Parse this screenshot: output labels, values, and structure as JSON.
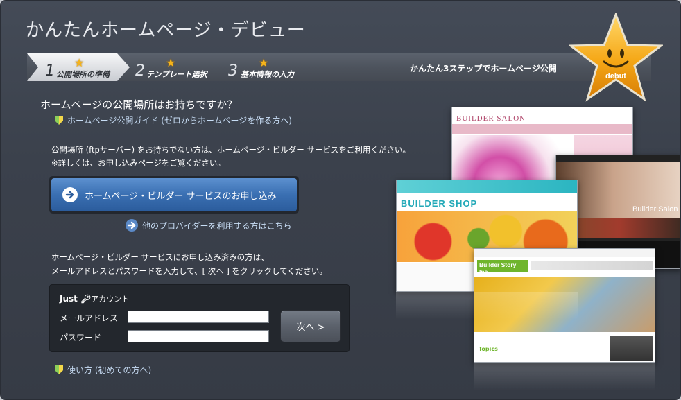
{
  "app_title": "かんたんホームページ・デビュー",
  "steps": [
    {
      "num": "1",
      "label": "公開場所の準備"
    },
    {
      "num": "2",
      "label": "テンプレート選択"
    },
    {
      "num": "3",
      "label": "基本情報の入力"
    }
  ],
  "tagline": "かんたん3ステップでホームページ公開",
  "badge_text": "debut",
  "question": "ホームページの公開場所はお持ちですか？",
  "guide_link": "ホームページ公開ガイド (ゼロからホームページを作る方へ)",
  "desc1_line1": "公開場所 (ftpサーバー) をお持ちでない方は、ホームページ・ビルダー サービスをご利用ください。",
  "desc1_line2": "※詳しくは、お申し込みページをご覧ください。",
  "apply_button": "ホームページ・ビルダー サービスのお申し込み",
  "provider_link": "他のプロバイダーを利用する方はこちら",
  "desc2_line1": "ホームページ・ビルダー サービスにお申し込み済みの方は、",
  "desc2_line2": "メールアドレスとパスワードを入力して、[ 次へ ] をクリックしてください。",
  "login": {
    "title_prefix": "Just",
    "title_suffix": "アカウント",
    "email_label": "メールアドレス",
    "email_value": "",
    "password_label": "パスワード",
    "password_value": "",
    "next_button": "次へ >"
  },
  "usage_link": "使い方 (初めての方へ)",
  "previews": {
    "salon_title": "BUILDER SALON",
    "salon2_title": "Builder Salon",
    "shop_title": "BUILDER SHOP",
    "story_title": "Builder Story Inc.",
    "story_topics": "Topics"
  },
  "colors": {
    "accent_star": "#f6b41a",
    "button_blue": "#3a6fb2",
    "link_blue": "#c8ddf5"
  }
}
